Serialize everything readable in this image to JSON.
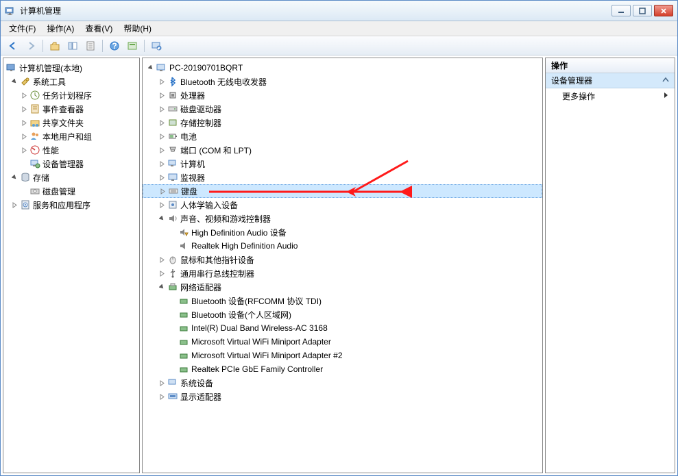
{
  "window": {
    "title": "计算机管理"
  },
  "menu": {
    "file": "文件(F)",
    "operation": "操作(A)",
    "view": "查看(V)",
    "help": "帮助(H)"
  },
  "left_tree": {
    "root": "计算机管理(本地)",
    "system_tools": "系统工具",
    "task_scheduler": "任务计划程序",
    "event_viewer": "事件查看器",
    "shared_folders": "共享文件夹",
    "local_users": "本地用户和组",
    "performance": "性能",
    "device_manager": "设备管理器",
    "storage": "存储",
    "disk_management": "磁盘管理",
    "services_apps": "服务和应用程序"
  },
  "center_tree": {
    "pc": "PC-20190701BQRT",
    "bluetooth": "Bluetooth 无线电收发器",
    "processors": "处理器",
    "disk_drives": "磁盘驱动器",
    "storage_controllers": "存储控制器",
    "batteries": "电池",
    "ports": "端口 (COM 和 LPT)",
    "computer": "计算机",
    "monitors": "监视器",
    "keyboards": "键盘",
    "hid": "人体学输入设备",
    "sound": "声音、视频和游戏控制器",
    "hd_audio": "High Definition Audio 设备",
    "realtek_audio": "Realtek High Definition Audio",
    "mice": "鼠标和其他指针设备",
    "usb": "通用串行总线控制器",
    "network": "网络适配器",
    "bt_rfcomm": "Bluetooth 设备(RFCOMM 协议 TDI)",
    "bt_pan": "Bluetooth 设备(个人区域网)",
    "intel_wifi": "Intel(R) Dual Band Wireless-AC 3168",
    "ms_vwifi1": "Microsoft Virtual WiFi Miniport Adapter",
    "ms_vwifi2": "Microsoft Virtual WiFi Miniport Adapter #2",
    "realtek_gbe": "Realtek PCIe GbE Family Controller",
    "system_devices": "系统设备",
    "display": "显示适配器"
  },
  "actions": {
    "header": "操作",
    "sub": "设备管理器",
    "more": "更多操作"
  }
}
